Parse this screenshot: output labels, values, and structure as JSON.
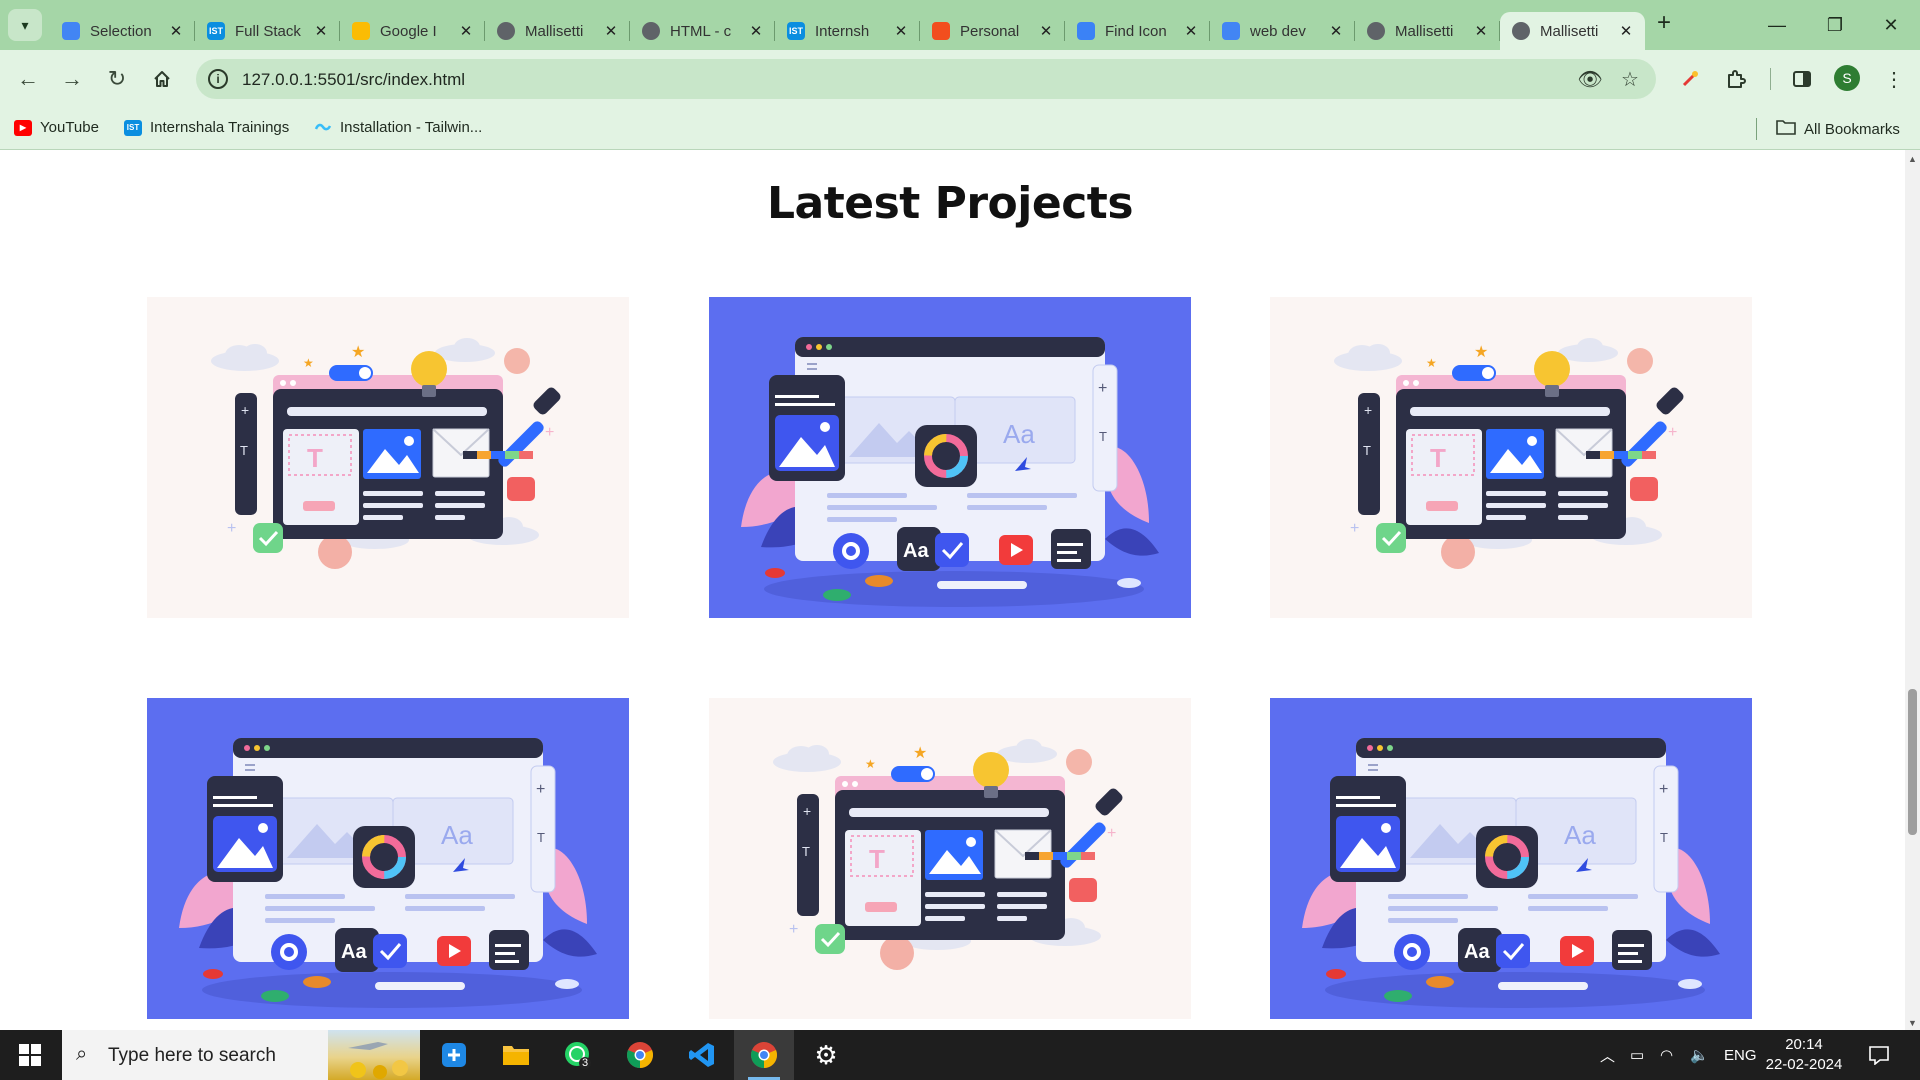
{
  "browser": {
    "tabs": [
      {
        "title": "Selection",
        "favicon": "multicolor-grid-icon",
        "color": "#4285f4"
      },
      {
        "title": "Full Stack",
        "favicon": "internshala-icon",
        "color": "#0a8ee0"
      },
      {
        "title": "Google I",
        "favicon": "google-drive-icon",
        "color": "#fbbc04"
      },
      {
        "title": "Mallisetti",
        "favicon": "globe-icon",
        "color": "#5f6368"
      },
      {
        "title": "HTML - c",
        "favicon": "globe-icon",
        "color": "#5f6368"
      },
      {
        "title": "Internsh",
        "favicon": "internshala-icon",
        "color": "#0a8ee0"
      },
      {
        "title": "Personal",
        "favicon": "figma-icon",
        "color": "#f24e1e"
      },
      {
        "title": "Find Icon",
        "favicon": "flag-icon",
        "color": "#3b82f6"
      },
      {
        "title": "web dev",
        "favicon": "google-icon",
        "color": "#4285f4"
      },
      {
        "title": "Mallisetti",
        "favicon": "globe-icon",
        "color": "#5f6368"
      },
      {
        "title": "Mallisetti",
        "favicon": "globe-icon",
        "color": "#5f6368",
        "active": true
      }
    ],
    "url": "127.0.0.1:5501/src/index.html",
    "bookmarks": [
      {
        "label": "YouTube",
        "icon": "youtube-icon"
      },
      {
        "label": "Internshala Trainings",
        "icon": "internshala-icon"
      },
      {
        "label": "Installation - Tailwin...",
        "icon": "tailwind-icon"
      }
    ],
    "all_bookmarks": "All Bookmarks",
    "profile_initial": "S",
    "internshala_badge": "IST"
  },
  "page": {
    "heading": "Latest Projects",
    "projects": [
      {
        "variant": "light"
      },
      {
        "variant": "blue"
      },
      {
        "variant": "light"
      },
      {
        "variant": "blue"
      },
      {
        "variant": "light"
      },
      {
        "variant": "blue"
      }
    ],
    "illustration_text": {
      "text_tool": "T",
      "font_preview": "Aa",
      "code_tag": "</>"
    }
  },
  "taskbar": {
    "search_placeholder": "Type here to search",
    "whatsapp_badge": "3",
    "language": "ENG",
    "time": "20:14",
    "date": "22-02-2024"
  },
  "colors": {
    "tabstrip": "#a5d6a7",
    "toolbar": "#e2f3e3",
    "card_light": "#fbf5f3",
    "card_blue": "#5c6ef0"
  }
}
